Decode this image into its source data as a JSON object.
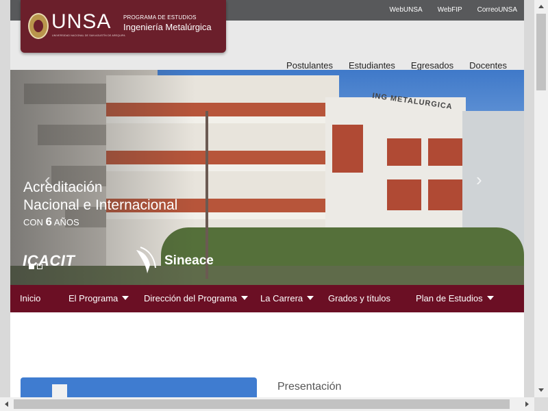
{
  "topbar": {
    "links": [
      "WebUNSA",
      "WebFIP",
      "CorreoUNSA"
    ]
  },
  "logo": {
    "brand": "UNSA",
    "subtitle": "UNIVERSIDAD NACIONAL DE SAN AGUSTÍN DE AREQUIPA",
    "program_small": "PROGRAMA DE ESTUDIOS",
    "program_name": "Ingeniería Metalúrgica"
  },
  "main_nav": [
    "Postulantes",
    "Estudiantes",
    "Egresados",
    "Docentes"
  ],
  "hero": {
    "line1": "Acreditación",
    "line2": "Nacional e Internacional",
    "line3_prefix": "CON ",
    "line3_number": "6",
    "line3_suffix": " AÑOS",
    "logo_left": "ICACIT",
    "logo_right": "Sineace",
    "building_sign": "ING METALURGICA",
    "slides": 2,
    "active_slide": 1
  },
  "menu": [
    {
      "label": "Inicio",
      "dropdown": false
    },
    {
      "label": "El Programa",
      "dropdown": true
    },
    {
      "label": "Dirección del Programa",
      "dropdown": true
    },
    {
      "label": "La Carrera",
      "dropdown": true
    },
    {
      "label": "Grados y títulos",
      "dropdown": false
    },
    {
      "label": "Plan de Estudios",
      "dropdown": true
    }
  ],
  "section": {
    "title": "Presentación"
  },
  "colors": {
    "brand": "#6b0f24",
    "logo_bg": "#6b1f2b",
    "topbar": "#58595b"
  }
}
